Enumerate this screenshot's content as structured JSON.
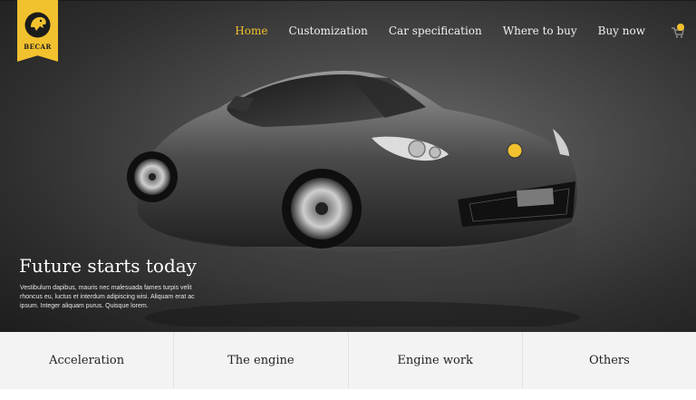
{
  "brand": {
    "name": "BECAR",
    "accent": "#f2c12e"
  },
  "nav": {
    "items": [
      {
        "label": "Home",
        "active": true
      },
      {
        "label": "Customization"
      },
      {
        "label": "Car specification"
      },
      {
        "label": "Where to buy"
      },
      {
        "label": "Buy now"
      }
    ],
    "cart_icon": "cart-icon"
  },
  "hero": {
    "title": "Future starts today",
    "text": "Vestibulum dapibus, mauris nec malesuada fames turpis velit rhoncus eu, luctus et interdum adipiscing wisi. Aliquam erat ac ipsum. Integer aliquam purus. Quisque lorem."
  },
  "features": [
    {
      "label": "Acceleration"
    },
    {
      "label": "The engine"
    },
    {
      "label": "Engine work"
    },
    {
      "label": "Others"
    }
  ]
}
